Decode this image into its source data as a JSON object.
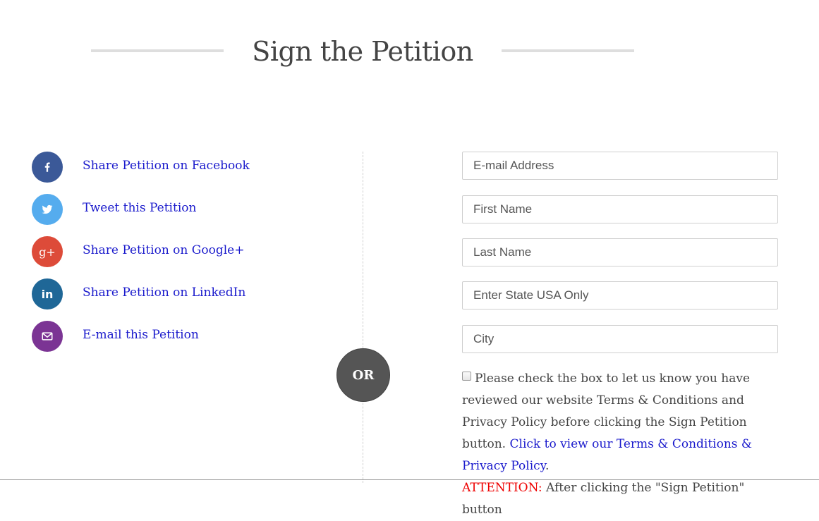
{
  "section": {
    "title": "Sign the Petition"
  },
  "share": {
    "items": [
      {
        "label": "Share Petition on Facebook",
        "icon": "facebook-icon",
        "color": "#3b5998"
      },
      {
        "label": "Tweet this Petition",
        "icon": "twitter-icon",
        "color": "#55acee"
      },
      {
        "label": "Share Petition on Google+",
        "icon": "google-plus-icon",
        "color": "#dd4b39"
      },
      {
        "label": "Share Petition on LinkedIn",
        "icon": "linkedin-icon",
        "color": "#1f6797"
      },
      {
        "label": "E-mail this Petition",
        "icon": "email-icon",
        "color": "#7b3494"
      }
    ],
    "or_label": "OR"
  },
  "form": {
    "email_placeholder": "E-mail Address",
    "first_name_placeholder": "First Name",
    "last_name_placeholder": "Last Name",
    "state_placeholder": "Enter State USA Only",
    "city_placeholder": "City",
    "consent_text": "Please check the box to let us know you have reviewed our website Terms & Conditions and Privacy Policy before clicking the Sign Petition button.",
    "consent_link": "Click to view our Terms & Conditions & Privacy Policy",
    "consent_period": ".",
    "attention_label": "ATTENTION:",
    "attention_text": "After clicking the \"Sign Petition\" button"
  }
}
